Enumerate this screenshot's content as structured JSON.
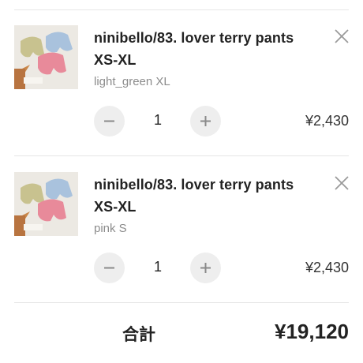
{
  "cart": {
    "items": [
      {
        "product_name": "ninibello/83. lover terry pants XS-XL",
        "variant": "light_green XL",
        "quantity": "1",
        "price": "¥2,430",
        "image_icon": "product-photo-shorts"
      },
      {
        "product_name": "ninibello/83. lover terry pants XS-XL",
        "variant": "pink S",
        "quantity": "1",
        "price": "¥2,430",
        "image_icon": "product-photo-shorts"
      }
    ],
    "controls": {
      "remove_icon": "close-icon",
      "decrease_icon": "minus-icon",
      "increase_icon": "plus-icon",
      "button_bg_color": "#eeeeee",
      "icon_color": "#9a9a9a"
    },
    "summary": {
      "total_label": "合計",
      "total_value": "¥19,120"
    }
  }
}
